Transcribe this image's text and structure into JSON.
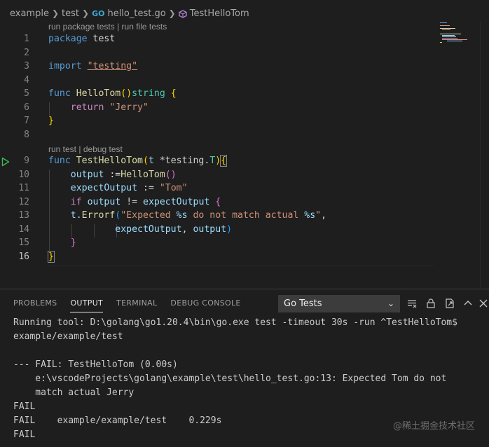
{
  "breadcrumb": {
    "items": [
      "example",
      "test",
      "hello_test.go",
      "TestHelloTom"
    ],
    "go_icon": "GO"
  },
  "codelens": {
    "package_tests": "run package tests",
    "file_tests": "run file tests",
    "run_test": "run test",
    "debug_test": "debug test",
    "separator": "|"
  },
  "editor": {
    "lines": [
      {
        "num": "1"
      },
      {
        "num": "2"
      },
      {
        "num": "3"
      },
      {
        "num": "4"
      },
      {
        "num": "5"
      },
      {
        "num": "6"
      },
      {
        "num": "7"
      },
      {
        "num": "8"
      },
      {
        "num": "9"
      },
      {
        "num": "10"
      },
      {
        "num": "11"
      },
      {
        "num": "12"
      },
      {
        "num": "13"
      },
      {
        "num": "14"
      },
      {
        "num": "15"
      },
      {
        "num": "16"
      }
    ],
    "tokens": {
      "l1": [
        "package",
        "test"
      ],
      "l3": [
        "import",
        "\"testing\""
      ],
      "l5": [
        "func",
        "HelloTom",
        "()",
        "string",
        "{"
      ],
      "l6": [
        "return",
        "\"Jerry\""
      ],
      "l7": [
        "}"
      ],
      "l9": [
        "func",
        "TestHelloTom",
        "(",
        "t",
        "*testing.",
        "T",
        ")",
        "{"
      ],
      "l10": [
        "output",
        ":=",
        "HelloTom",
        "()"
      ],
      "l11": [
        "expectOutput",
        ":=",
        "\"Tom\""
      ],
      "l12": [
        "if",
        "output",
        "!=",
        "expectOutput",
        "{"
      ],
      "l13": [
        "t.",
        "Errorf",
        "(",
        "\"Expected ",
        "%s",
        " do not match actual ",
        "%s",
        "\"",
        ","
      ],
      "l14": [
        "expectOutput",
        ",",
        "output",
        ")"
      ],
      "l15": [
        "}"
      ],
      "l16": [
        "}"
      ]
    }
  },
  "panel": {
    "tabs": [
      "PROBLEMS",
      "OUTPUT",
      "TERMINAL",
      "DEBUG CONSOLE"
    ],
    "active_tab": "OUTPUT",
    "channel_select": "Go Tests",
    "output_lines": [
      "Running tool: D:\\golang\\go1.20.4\\bin\\go.exe test -timeout 30s -run ^TestHelloTom$",
      "example/example/test",
      "",
      "--- FAIL: TestHelloTom (0.00s)",
      "    e:\\vscodeProjects\\golang\\example\\test\\hello_test.go:13: Expected Tom do not",
      "    match actual Jerry",
      "FAIL",
      "FAIL    example/example/test    0.229s",
      "FAIL"
    ]
  },
  "watermark": "@稀土掘金技术社区",
  "colors": {
    "background": "#1e1e1e",
    "keyword": "#569cd6",
    "control": "#c586c0",
    "function": "#dcdcaa",
    "string": "#ce9178",
    "variable": "#9cdcfe",
    "type": "#4ec9b0",
    "run_icon": "#3fb950"
  }
}
